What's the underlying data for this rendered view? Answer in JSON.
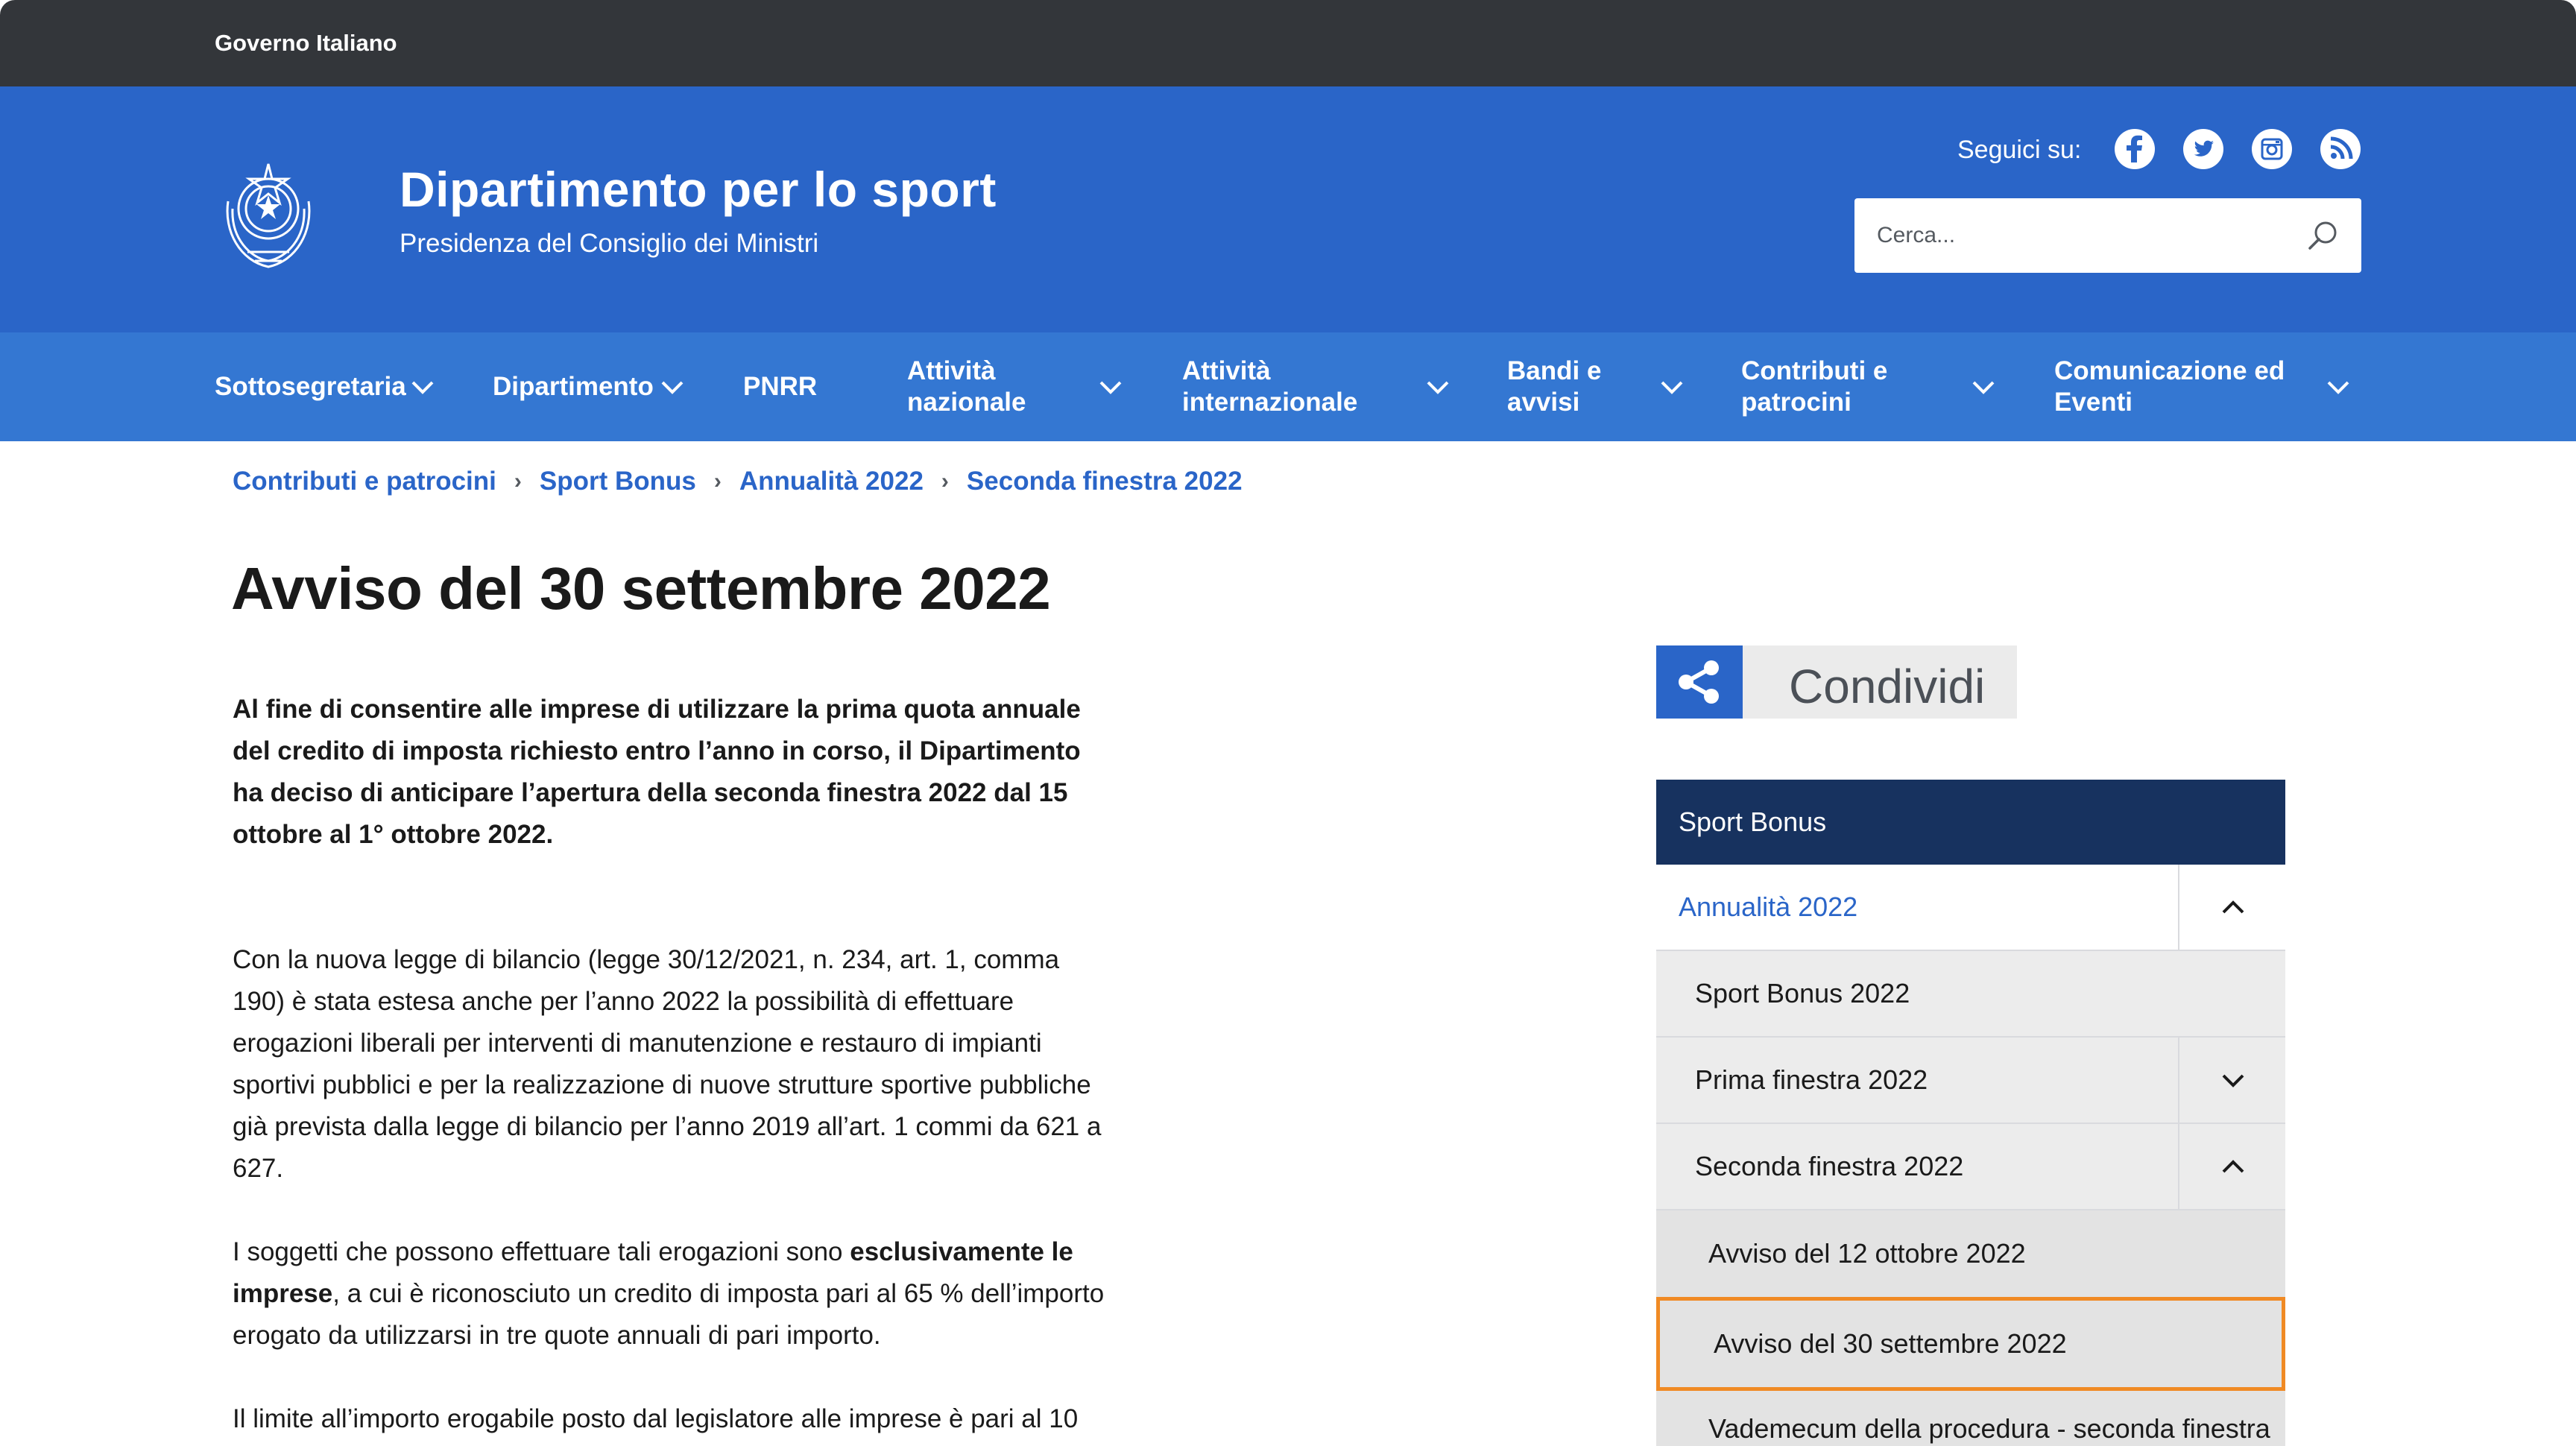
{
  "gov_bar": {
    "label": "Governo Italiano"
  },
  "header": {
    "title": "Dipartimento per lo sport",
    "subtitle": "Presidenza del Consiglio dei Ministri",
    "social_label": "Seguici su:",
    "social_icons": [
      "facebook-icon",
      "twitter-icon",
      "instagram-icon",
      "rss-icon"
    ],
    "search_placeholder": "Cerca..."
  },
  "nav": {
    "items": [
      {
        "label": "Sottosegretaria",
        "has_dropdown": true
      },
      {
        "label": "Dipartimento",
        "has_dropdown": true
      },
      {
        "label": "PNRR",
        "has_dropdown": false
      },
      {
        "label": "Attività\nnazionale",
        "has_dropdown": true
      },
      {
        "label": "Attività\ninternazionale",
        "has_dropdown": true
      },
      {
        "label": "Bandi e\navvisi",
        "has_dropdown": true
      },
      {
        "label": "Contributi e\npatrocini",
        "has_dropdown": true
      },
      {
        "label": "Comunicazione ed\nEventi",
        "has_dropdown": true
      }
    ]
  },
  "breadcrumb": {
    "items": [
      "Contributi e patrocini",
      "Sport Bonus",
      "Annualità 2022",
      "Seconda finestra 2022"
    ],
    "separator": "›"
  },
  "article": {
    "title": "Avviso del 30 settembre 2022",
    "lead": "Al fine di consentire alle imprese di utilizzare la prima quota annuale del credito di imposta richiesto entro l’anno in corso,  il Dipartimento ha deciso di anticipare l’apertura della seconda finestra 2022 dal 15 ottobre al 1° ottobre 2022.",
    "p1": "Con la nuova legge di bilancio (legge 30/12/2021, n. 234, art. 1, comma 190)  è stata estesa anche per l’anno 2022  la possibilità di effettuare erogazioni liberali per interventi di manutenzione e restauro di impianti sportivi pubblici e per la realizzazione di nuove strutture sportive pubbliche già prevista dalla legge di bilancio per l’anno 2019 all’art. 1 commi da 621 a 627.",
    "p2_before": "I soggetti che possono effettuare tali erogazioni sono ",
    "p2_bold": "esclusivamente le imprese",
    "p2_after": ", a cui è riconosciuto un credito di imposta pari al 65 % dell’importo erogato da utilizzarsi in tre quote annuali di pari importo.",
    "p3": "Il limite all’importo erogabile posto dal legislatore alle imprese è pari al 10"
  },
  "share": {
    "label": "Condividi"
  },
  "sidebar": {
    "header": "Sport Bonus",
    "items": [
      {
        "label": "Annualità 2022",
        "level": 1,
        "toggle": "up"
      },
      {
        "label": "Sport Bonus 2022",
        "level": 2,
        "toggle": "none"
      },
      {
        "label": "Prima finestra 2022",
        "level": 2,
        "toggle": "down"
      },
      {
        "label": "Seconda finestra 2022",
        "level": 2,
        "toggle": "up"
      },
      {
        "label": "Avviso del 12 ottobre 2022",
        "level": 3,
        "toggle": "none"
      },
      {
        "label": "Avviso del 30 settembre 2022",
        "level": 3,
        "toggle": "none",
        "active": true
      },
      {
        "label": "Vademecum della procedura - seconda finestra",
        "level": 3,
        "toggle": "none"
      }
    ]
  },
  "colors": {
    "gov_bar": "#33363a",
    "header": "#2a65c8",
    "nav": "#3477d2",
    "link": "#2a65c8",
    "sidebar_head": "#17325f",
    "active_outline": "#f08a24"
  }
}
